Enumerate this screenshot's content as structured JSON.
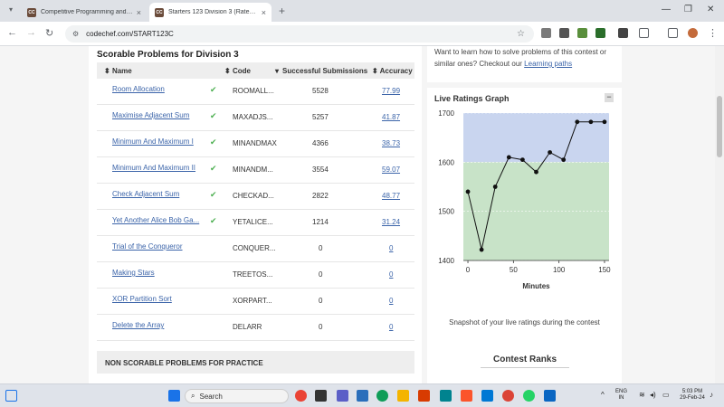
{
  "browser": {
    "tabs": [
      {
        "title": "Competitive Programming and Co",
        "favicon": "CC",
        "active": false
      },
      {
        "title": "Starters 123 Division 3 (Rated) Co",
        "favicon": "CC",
        "active": true
      }
    ],
    "new_tab_label": "+",
    "url": "codechef.com/START123C"
  },
  "problems": {
    "section_title": "Scorable Problems for Division 3",
    "columns": [
      "Name",
      "Code",
      "Successful Submissions",
      "Accuracy"
    ],
    "rows": [
      {
        "name": "Room Allocation",
        "solved": true,
        "code": "ROOMALL...",
        "submissions": "5528",
        "accuracy": "77.99"
      },
      {
        "name": "Maximise Adjacent Sum",
        "solved": true,
        "code": "MAXADJS...",
        "submissions": "5257",
        "accuracy": "41.87"
      },
      {
        "name": "Minimum And Maximum I",
        "solved": true,
        "code": "MINANDMAX",
        "submissions": "4366",
        "accuracy": "38.73"
      },
      {
        "name": "Minimum And Maximum II",
        "solved": true,
        "code": "MINANDM...",
        "submissions": "3554",
        "accuracy": "59.07"
      },
      {
        "name": "Check Adjacent Sum",
        "solved": true,
        "code": "CHECKAD...",
        "submissions": "2822",
        "accuracy": "48.77"
      },
      {
        "name": "Yet Another Alice Bob Ga...",
        "solved": true,
        "code": "YETALICE...",
        "submissions": "1214",
        "accuracy": "31.24"
      },
      {
        "name": "Trial of the Conqueror",
        "solved": false,
        "code": "CONQUER...",
        "submissions": "0",
        "accuracy": "0"
      },
      {
        "name": "Making Stars",
        "solved": false,
        "code": "TREETOS...",
        "submissions": "0",
        "accuracy": "0"
      },
      {
        "name": "XOR Partition Sort",
        "solved": false,
        "code": "XORPART...",
        "submissions": "0",
        "accuracy": "0"
      },
      {
        "name": "Delete the Array",
        "solved": false,
        "code": "DELARR",
        "submissions": "0",
        "accuracy": "0"
      }
    ],
    "non_scorable_title": "NON SCORABLE PROBLEMS FOR PRACTICE"
  },
  "sidebar": {
    "learn_text_1": "Want to learn how to solve problems of this contest or",
    "learn_text_2": "similar ones? Checkout our",
    "learn_link": "Learning paths",
    "graph_title": "Live Ratings Graph",
    "collapse_label": "−",
    "snapshot_text": "Snapshot of your live ratings during the contest",
    "contest_ranks_title": "Contest Ranks"
  },
  "chart_data": {
    "type": "line",
    "title": "",
    "xlabel": "Minutes",
    "ylabel": "",
    "xlim": [
      -5,
      155
    ],
    "ylim": [
      1400,
      1700
    ],
    "xticks": [
      0,
      50,
      100,
      150
    ],
    "yticks": [
      1400,
      1500,
      1600,
      1700
    ],
    "bands": [
      {
        "from": 1600,
        "to": 1700,
        "color": "#c9d5ef"
      },
      {
        "from": 1400,
        "to": 1600,
        "color": "#c8e3c8"
      }
    ],
    "series": [
      {
        "x": [
          0,
          15,
          30,
          45,
          60,
          75,
          90,
          105,
          120,
          135,
          150
        ],
        "y": [
          1540,
          1422,
          1550,
          1610,
          1605,
          1580,
          1620,
          1605,
          1682,
          1682,
          1682
        ]
      }
    ]
  },
  "taskbar": {
    "search_placeholder": "Search",
    "lang_top": "ENG",
    "lang_bottom": "IN",
    "time": "5:03 PM",
    "date": "29-Feb-24"
  }
}
